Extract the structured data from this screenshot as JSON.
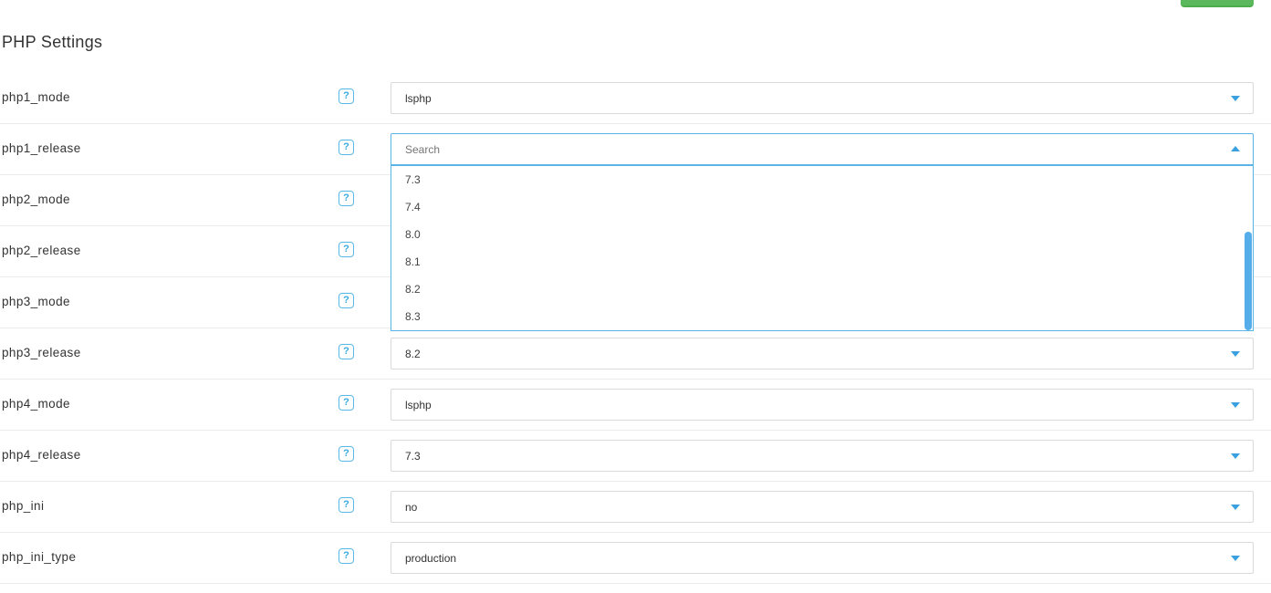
{
  "page": {
    "title": "PHP Settings"
  },
  "help_glyph": "?",
  "rows": [
    {
      "label": "php1_mode",
      "value": "lsphp"
    },
    {
      "label": "php1_release",
      "value": ""
    },
    {
      "label": "php2_mode",
      "value": ""
    },
    {
      "label": "php2_release",
      "value": ""
    },
    {
      "label": "php3_mode",
      "value": ""
    },
    {
      "label": "php3_release",
      "value": "8.2"
    },
    {
      "label": "php4_mode",
      "value": "lsphp"
    },
    {
      "label": "php4_release",
      "value": "7.3"
    },
    {
      "label": "php_ini",
      "value": "no"
    },
    {
      "label": "php_ini_type",
      "value": "production"
    }
  ],
  "open_dropdown": {
    "search_placeholder": "Search",
    "options": [
      "7.3",
      "7.4",
      "8.0",
      "8.1",
      "8.2",
      "8.3"
    ]
  },
  "colors": {
    "accent": "#3aa0e0",
    "border": "#d9d9d9",
    "focus_border": "#5bb4e5",
    "button": "#5cb85c"
  }
}
